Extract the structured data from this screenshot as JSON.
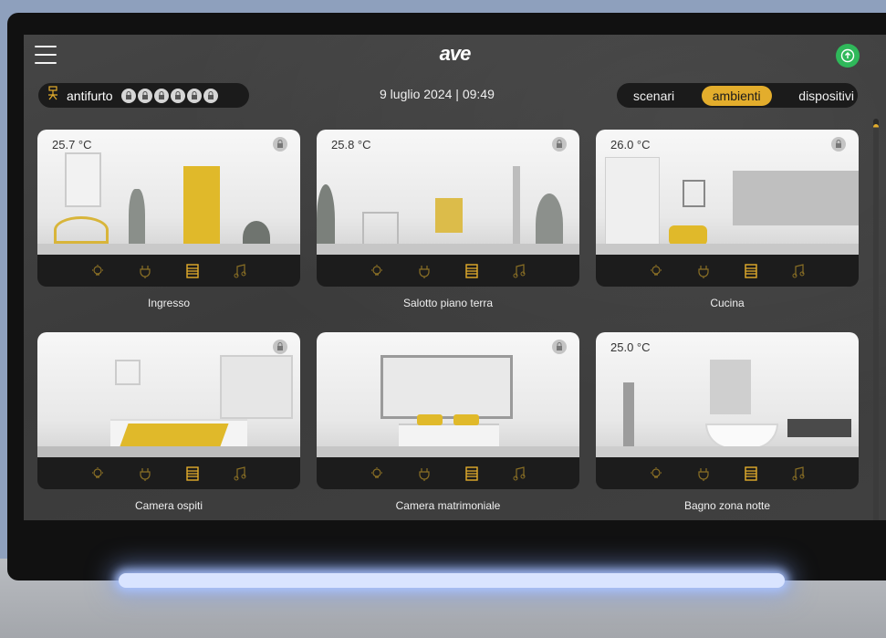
{
  "app": {
    "logo": "ave"
  },
  "topbar": {
    "alarm_label": "antifurto",
    "alarm_zones": 6,
    "datetime": "9 luglio 2024 | 09:49",
    "tabs": [
      {
        "label": "scenari",
        "active": false
      },
      {
        "label": "ambienti",
        "active": true
      },
      {
        "label": "dispositivi",
        "active": false
      }
    ]
  },
  "rooms": [
    {
      "name": "Ingresso",
      "temperature": "25.7 °C"
    },
    {
      "name": "Salotto piano terra",
      "temperature": "25.8 °C"
    },
    {
      "name": "Cucina",
      "temperature": "26.0 °C"
    },
    {
      "name": "Camera ospiti",
      "temperature": ""
    },
    {
      "name": "Camera matrimoniale",
      "temperature": ""
    },
    {
      "name": "Bagno zona notte",
      "temperature": "25.0 °C"
    }
  ],
  "card_icons": [
    "light-icon",
    "plug-icon",
    "shutter-icon",
    "music-icon"
  ],
  "colors": {
    "accent": "#e3ad2c",
    "screen_bg": "#3f3f3f",
    "pill_bg": "#1b1b1b",
    "cloud_green": "#2fb85a"
  }
}
